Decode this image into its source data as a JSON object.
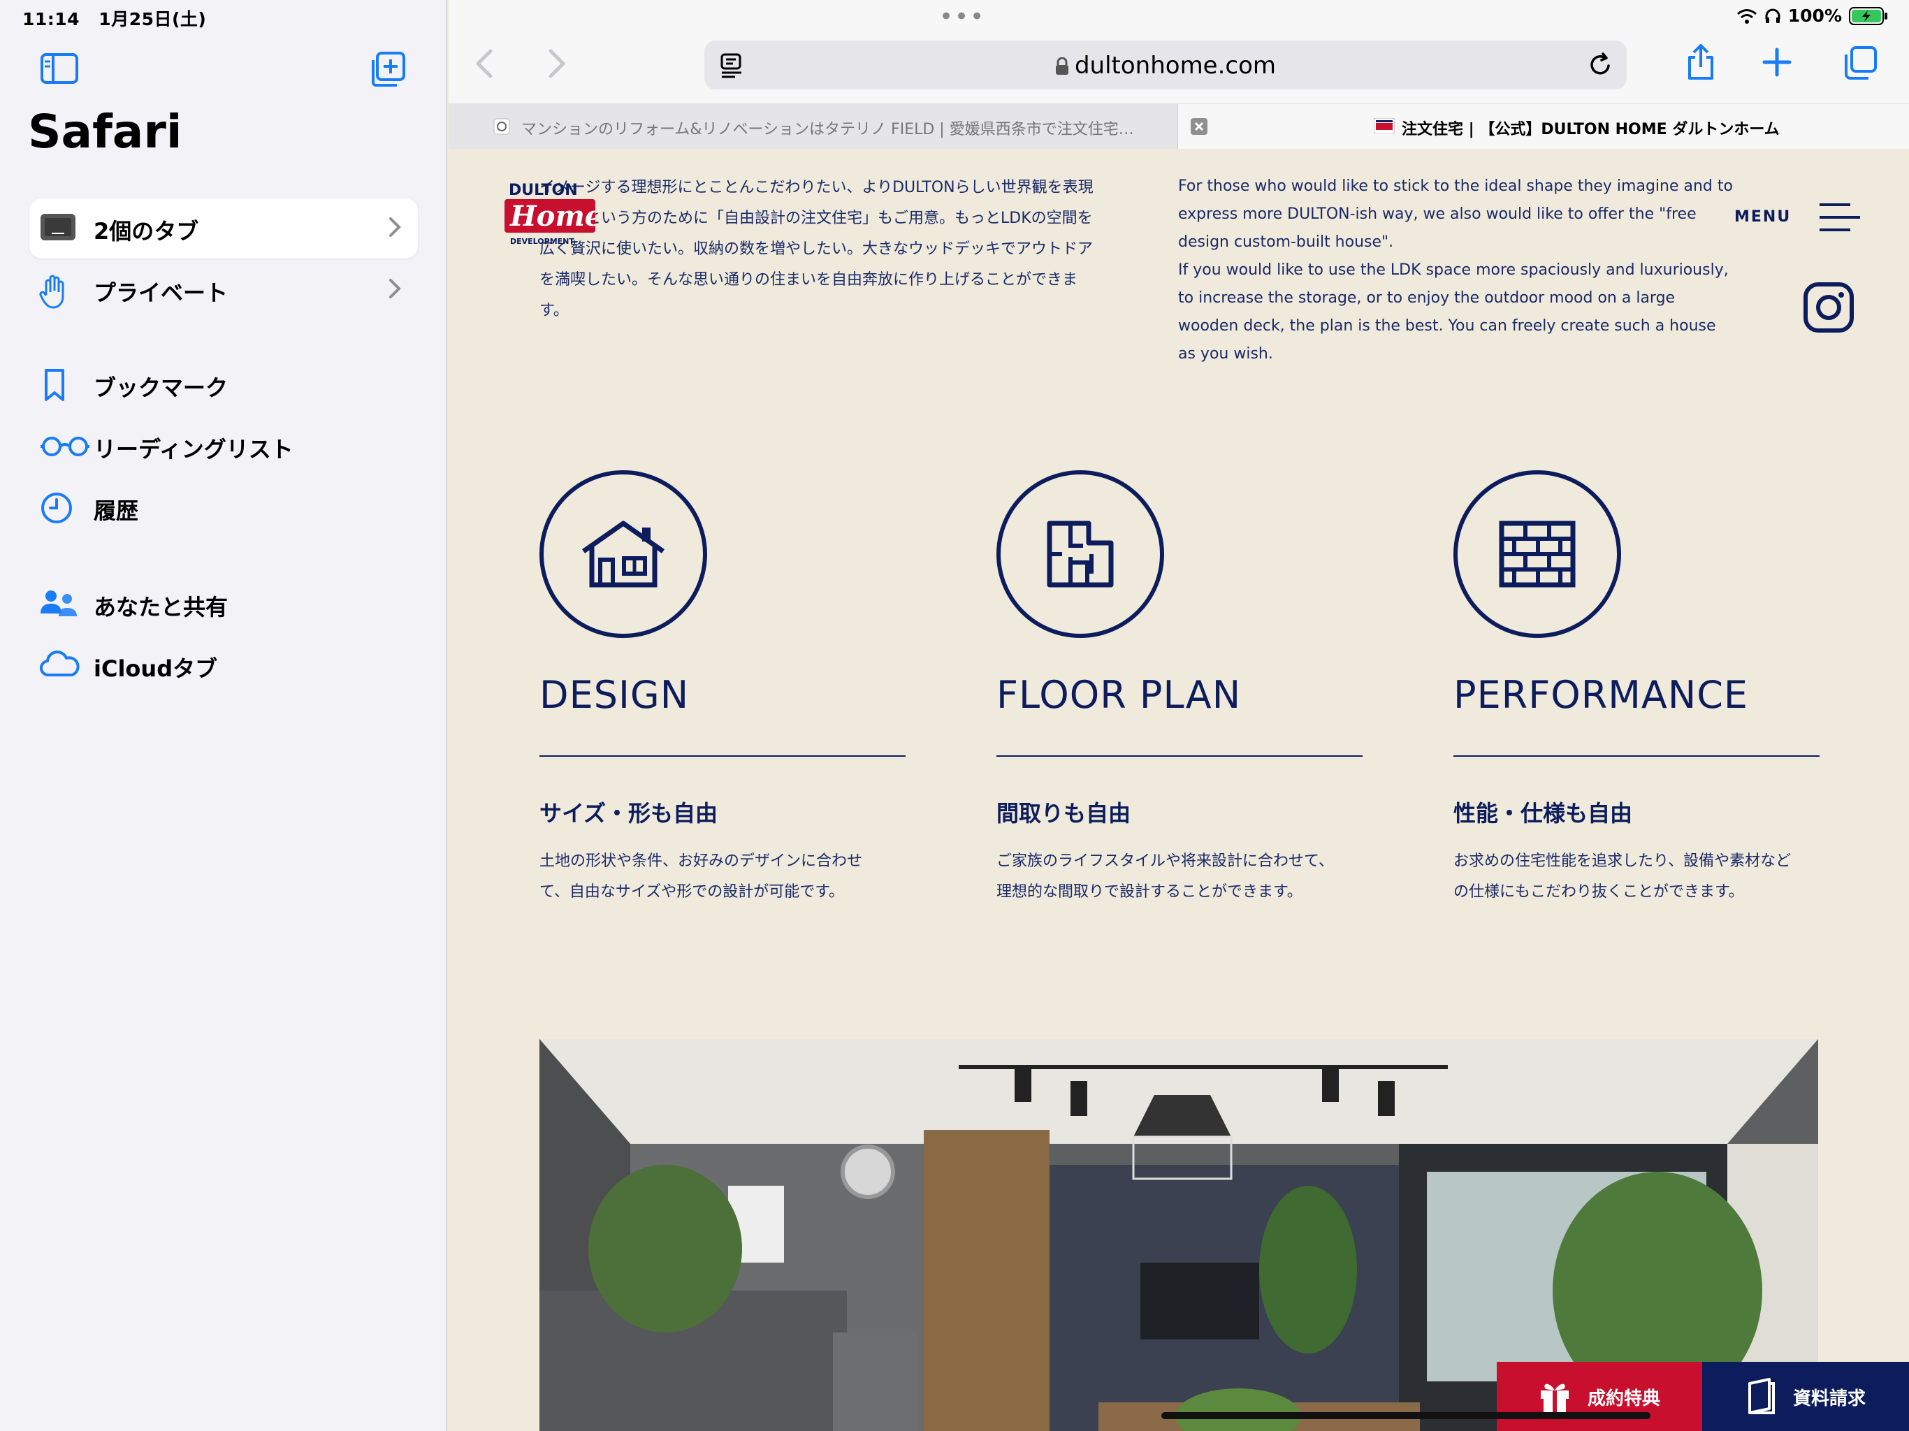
{
  "status": {
    "time": "11:14",
    "date": "1月25日(土)",
    "battery": "100%"
  },
  "sidebar": {
    "title": "Safari",
    "tab_groups": [
      {
        "label": "2個のタブ"
      },
      {
        "label": "プライベート"
      }
    ],
    "nav_items": [
      {
        "label": "ブックマーク",
        "icon": "bookmark-icon"
      },
      {
        "label": "リーディングリスト",
        "icon": "glasses-icon"
      },
      {
        "label": "履歴",
        "icon": "clock-icon"
      },
      {
        "label": "あなたと共有",
        "icon": "shared-people-icon"
      },
      {
        "label": "iCloudタブ",
        "icon": "cloud-icon"
      }
    ]
  },
  "browser": {
    "url": "dultonhome.com",
    "tabs": [
      {
        "label": "マンションのリフォーム&リノベーションはタテリノ FIELD | 愛媛県西条市で注文住宅…"
      },
      {
        "label": "注文住宅 | 【公式】DULTON HOME ダルトンホーム"
      }
    ]
  },
  "page": {
    "logo": {
      "top": "DULTON",
      "middle": "Home",
      "bottom": "DEVELOPMENT"
    },
    "jp_intro": "イメージする理想形にとことんこだわりたい、よりDULTONらしい世界観を表現したいという方のために「自由設計の注文住宅」もご用意。もっとLDKの空間を広く贅沢に使いたい。収納の数を増やしたい。大きなウッドデッキでアウトドアを満喫したい。そんな思い通りの住まいを自由奔放に作り上げることができます。",
    "en_intro_1": "For those who would like to stick to the ideal shape they imagine and to express more DULTON-ish way, we also would like to offer the \"free design custom-built house\".",
    "en_intro_2": "If you would like to use the LDK space more spaciously and luxuriously, to increase the storage, or to enjoy the outdoor mood on a large wooden deck, the plan is the best. You can freely create such a house as you wish.",
    "menu_label": "MENU",
    "features": [
      {
        "title": "DESIGN",
        "subtitle": "サイズ・形も自由",
        "desc": "土地の形状や条件、お好みのデザインに合わせて、自由なサイズや形での設計が可能です。",
        "icon": "house-icon"
      },
      {
        "title": "FLOOR PLAN",
        "subtitle": "間取りも自由",
        "desc": "ご家族のライフスタイルや将来設計に合わせて、理想的な間取りで設計することができます。",
        "icon": "floorplan-icon"
      },
      {
        "title": "PERFORMANCE",
        "subtitle": "性能・仕様も自由",
        "desc": "お求めの住宅性能を追求したり、設備や素材などの仕様にもこだわり抜くことができます。",
        "icon": "brick-wall-icon"
      }
    ],
    "cta": {
      "benefit_label": "成約特典",
      "request_label": "資料請求"
    }
  }
}
